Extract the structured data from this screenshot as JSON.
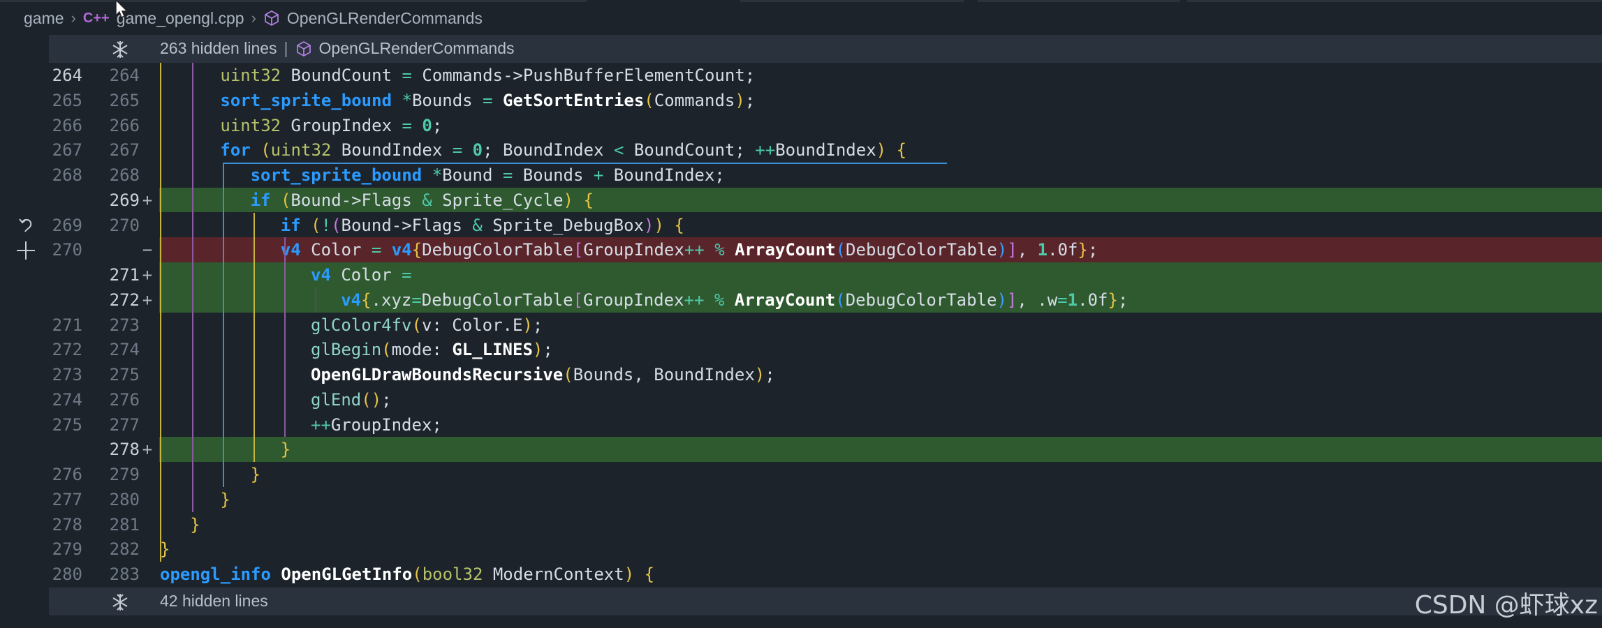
{
  "breadcrumb": {
    "root": "game",
    "file": "game_opengl.cpp",
    "file_icon": "C++",
    "symbol": "OpenGLRenderCommands"
  },
  "fold_top": {
    "hidden": "263 hidden lines",
    "divider": "|",
    "symbol": "OpenGLRenderCommands"
  },
  "fold_bottom": {
    "hidden": "42 hidden lines"
  },
  "watermark": "CSDN @虾球xz",
  "colors": {
    "added": "#2f5a2f",
    "removed": "#5a252a",
    "keyword": "#2b9bff"
  },
  "lines": [
    {
      "a": "264",
      "b": "264",
      "mark": "",
      "text": "uint32 BoundCount = Commands->PushBufferElementCount;"
    },
    {
      "a": "265",
      "b": "265",
      "mark": "",
      "text": "sort_sprite_bound *Bounds = GetSortEntries(Commands);"
    },
    {
      "a": "266",
      "b": "266",
      "mark": "",
      "text": "uint32 GroupIndex = 0;"
    },
    {
      "a": "267",
      "b": "267",
      "mark": "",
      "text": "for (uint32 BoundIndex = 0; BoundIndex < BoundCount; ++BoundIndex) {"
    },
    {
      "a": "268",
      "b": "268",
      "mark": "",
      "text": "sort_sprite_bound *Bound = Bounds + BoundIndex;"
    },
    {
      "a": "",
      "b": "269",
      "mark": "+",
      "text": "if (Bound->Flags & Sprite_Cycle) {"
    },
    {
      "a": "269",
      "b": "270",
      "mark": "",
      "text": "if (!(Bound->Flags & Sprite_DebugBox)) {"
    },
    {
      "a": "270",
      "b": "",
      "mark": "−",
      "text": "v4 Color = v4{DebugColorTable[GroupIndex++ % ArrayCount(DebugColorTable)], 1.0f};"
    },
    {
      "a": "",
      "b": "271",
      "mark": "+",
      "text": "v4 Color ="
    },
    {
      "a": "",
      "b": "272",
      "mark": "+",
      "text": "v4{.xyz=DebugColorTable[GroupIndex++ % ArrayCount(DebugColorTable)], .w=1.0f};"
    },
    {
      "a": "271",
      "b": "273",
      "mark": "",
      "text": "glColor4fv(v: Color.E);"
    },
    {
      "a": "272",
      "b": "274",
      "mark": "",
      "text": "glBegin(mode: GL_LINES);"
    },
    {
      "a": "273",
      "b": "275",
      "mark": "",
      "text": "OpenGLDrawBoundsRecursive(Bounds, BoundIndex);"
    },
    {
      "a": "274",
      "b": "276",
      "mark": "",
      "text": "glEnd();"
    },
    {
      "a": "275",
      "b": "277",
      "mark": "",
      "text": "++GroupIndex;"
    },
    {
      "a": "",
      "b": "278",
      "mark": "+",
      "text": "}"
    },
    {
      "a": "276",
      "b": "279",
      "mark": "",
      "text": "}"
    },
    {
      "a": "277",
      "b": "280",
      "mark": "",
      "text": "}"
    },
    {
      "a": "278",
      "b": "281",
      "mark": "",
      "text": "}"
    },
    {
      "a": "279",
      "b": "282",
      "mark": "",
      "text": "}"
    },
    {
      "a": "280",
      "b": "283",
      "mark": "",
      "text": "opengl_info OpenGLGetInfo(bool32 ModernContext) {"
    }
  ]
}
